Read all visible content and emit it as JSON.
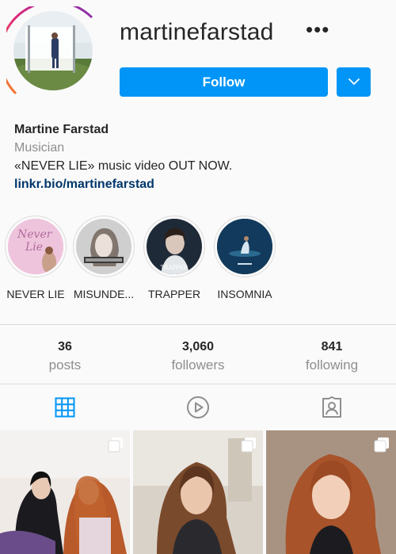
{
  "profile": {
    "username": "martinefarstad",
    "more_label": "•••",
    "follow_label": "Follow",
    "display_name": "Martine Farstad",
    "category": "Musician",
    "bio": "«NEVER LIE» music video OUT NOW.",
    "link": "linkr.bio/martinefarstad"
  },
  "highlights": [
    {
      "label": "NEVER LIE",
      "icon": "highlight-never-lie"
    },
    {
      "label": "MISUNDE...",
      "icon": "highlight-misunderstood"
    },
    {
      "label": "TRAPPER",
      "icon": "highlight-trapper"
    },
    {
      "label": "INSOMNIA",
      "icon": "highlight-insomnia"
    }
  ],
  "highlight_texts": {
    "never": "Never",
    "lie": "Lie",
    "trapper": "TRAPPER"
  },
  "stats": {
    "posts": {
      "value": "36",
      "label": "posts"
    },
    "followers": {
      "value": "3,060",
      "label": "followers"
    },
    "following": {
      "value": "841",
      "label": "following"
    }
  },
  "tabs": [
    "grid-icon",
    "reels-icon",
    "tagged-icon"
  ],
  "colors": {
    "accent": "#0095f6",
    "link": "#00376b",
    "muted": "#8e8e8e",
    "border": "#dbdbdb"
  }
}
